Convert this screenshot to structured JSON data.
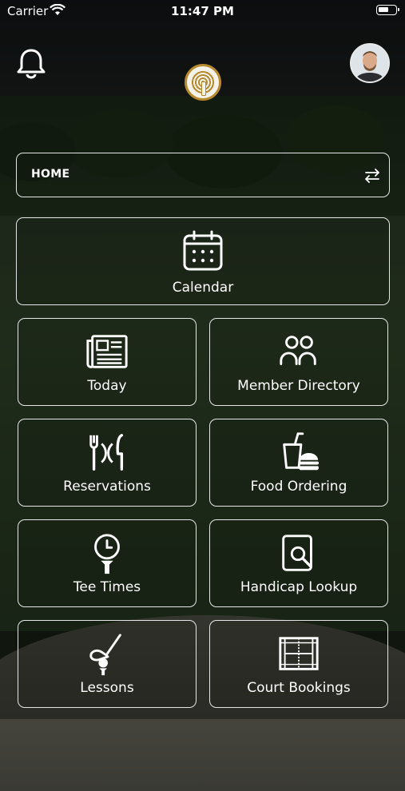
{
  "status_bar": {
    "carrier": "Carrier",
    "time": "11:47 PM"
  },
  "header": {
    "logo_icon": "club-logo",
    "notifications_icon": "bell-icon",
    "avatar": "user-avatar"
  },
  "selector": {
    "label": "HOME",
    "icon": "swap-arrows-icon"
  },
  "tiles": [
    {
      "label": "Calendar",
      "icon": "calendar-icon"
    },
    {
      "label": "Today",
      "icon": "newspaper-icon"
    },
    {
      "label": "Member Directory",
      "icon": "people-icon"
    },
    {
      "label": "Reservations",
      "icon": "dining-icon"
    },
    {
      "label": "Food Ordering",
      "icon": "drink-burger-icon"
    },
    {
      "label": "Tee Times",
      "icon": "tee-clock-icon"
    },
    {
      "label": "Handicap Lookup",
      "icon": "search-document-icon"
    },
    {
      "label": "Lessons",
      "icon": "golf-club-icon"
    },
    {
      "label": "Court Bookings",
      "icon": "tennis-court-icon"
    }
  ]
}
